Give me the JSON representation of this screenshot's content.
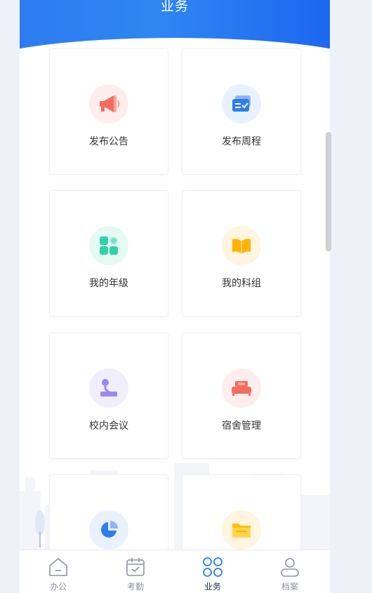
{
  "header": {
    "title": "业务"
  },
  "grid": {
    "items": [
      {
        "label": "发布公告",
        "icon": "megaphone-icon",
        "color": "#f26c5f",
        "bg": "#fdeeed"
      },
      {
        "label": "发布周程",
        "icon": "schedule-card-icon",
        "color": "#2f7cf0",
        "bg": "#e9f1fe"
      },
      {
        "label": "我的年级",
        "icon": "grade-blocks-icon",
        "color": "#2fd3a8",
        "bg": "#e6faf4"
      },
      {
        "label": "我的科组",
        "icon": "book-icon",
        "color": "#ffb300",
        "bg": "#fff5e0"
      },
      {
        "label": "校内会议",
        "icon": "meeting-mic-icon",
        "color": "#9a88ee",
        "bg": "#f1eefc"
      },
      {
        "label": "宿舍管理",
        "icon": "bed-icon",
        "color": "#f26c5f",
        "bg": "#fdeeed"
      },
      {
        "label": "",
        "icon": "pie-chart-icon",
        "color": "#2f7cf0",
        "bg": "#e9f1fe"
      },
      {
        "label": "",
        "icon": "folder-icon",
        "color": "#ffc107",
        "bg": "#fff5e0"
      }
    ]
  },
  "tabbar": {
    "items": [
      {
        "label": "办公",
        "icon": "home-icon",
        "active": false
      },
      {
        "label": "考勤",
        "icon": "calendar-check-icon",
        "active": false
      },
      {
        "label": "业务",
        "icon": "grid-clover-icon",
        "active": true
      },
      {
        "label": "档案",
        "icon": "profile-icon",
        "active": false
      }
    ]
  },
  "colors": {
    "primary": "#2d7cf0",
    "background": "#eef2f8",
    "inactive_tab": "#8d939e"
  }
}
